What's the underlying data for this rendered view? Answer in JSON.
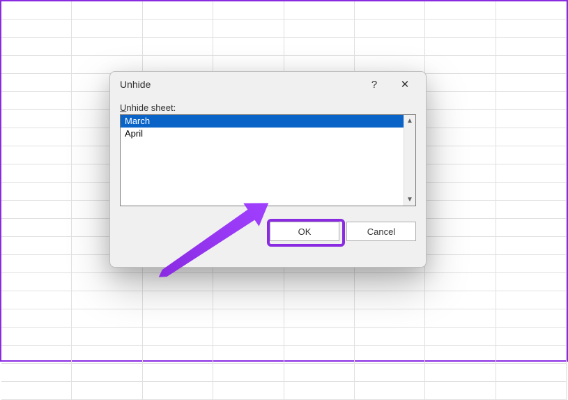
{
  "dialog": {
    "title": "Unhide",
    "help_symbol": "?",
    "close_symbol": "✕",
    "field_label_prefix": "U",
    "field_label_rest": "nhide sheet:",
    "items": [
      "March",
      "April"
    ],
    "selected_index": 0,
    "ok_label": "OK",
    "cancel_label": "Cancel"
  },
  "annotation": {
    "highlight_color": "#8a2be2"
  }
}
